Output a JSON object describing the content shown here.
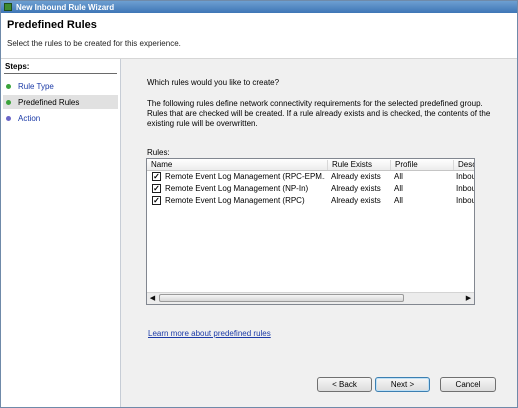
{
  "window": {
    "title": "New Inbound Rule Wizard"
  },
  "header": {
    "title": "Predefined Rules",
    "subtitle": "Select the rules to be created for this experience."
  },
  "steps": {
    "title": "Steps:",
    "items": [
      {
        "label": "Rule Type",
        "dot_color": "#3aa33a"
      },
      {
        "label": "Predefined Rules",
        "dot_color": "#3aa33a"
      },
      {
        "label": "Action",
        "dot_color": "#6b66c8"
      }
    ]
  },
  "main": {
    "question": "Which rules would you like to create?",
    "description": "The following rules define network connectivity requirements for the selected predefined group. Rules that are checked will be created. If a rule already exists and is checked, the contents of the existing rule will be overwritten.",
    "rules_label": "Rules:",
    "columns": [
      "Name",
      "Rule Exists",
      "Profile",
      "Desc"
    ],
    "rows": [
      {
        "checked": true,
        "name": "Remote Event Log Management (RPC-EPM...",
        "exists": "Already exists",
        "profile": "All",
        "desc": "Inbou"
      },
      {
        "checked": true,
        "name": "Remote Event Log Management (NP-In)",
        "exists": "Already exists",
        "profile": "All",
        "desc": "Inbou"
      },
      {
        "checked": true,
        "name": "Remote Event Log Management (RPC)",
        "exists": "Already exists",
        "profile": "All",
        "desc": "Inbou"
      }
    ],
    "link": "Learn more about predefined rules"
  },
  "buttons": {
    "back": "< Back",
    "next": "Next >",
    "cancel": "Cancel"
  }
}
